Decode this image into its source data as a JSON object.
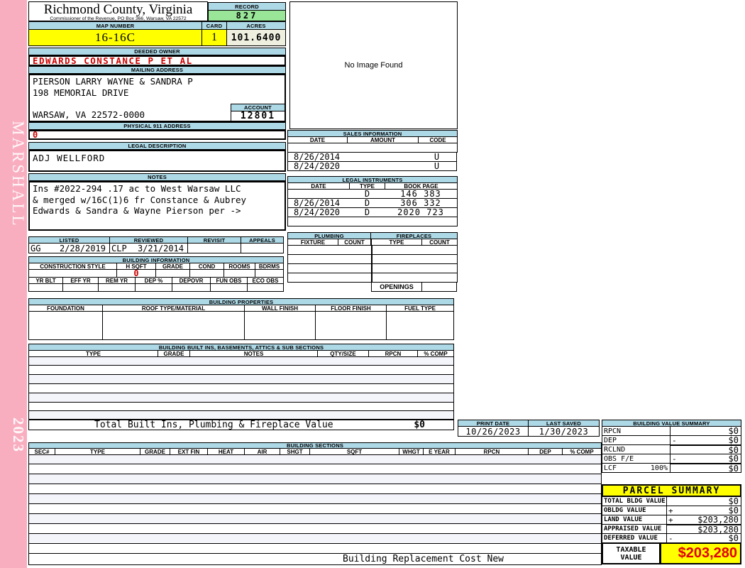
{
  "sidebar": {
    "year_book": "MARSHALL",
    "year": "2023"
  },
  "header": {
    "county": "Richmond County, Virginia",
    "commissioner": "Commissioner of the Revenue, PO Box 366, Warsaw, VA 22572",
    "record_label": "RECORD",
    "record_value": "827",
    "map_number_label": "MAP NUMBER",
    "map_number_value": "16-16C",
    "card_label": "CARD",
    "card_value": "1",
    "acres_label": "ACRES",
    "acres_value": "101.6400"
  },
  "owner": {
    "deeded_owner_label": "DEEDED OWNER",
    "deeded_owner": "EDWARDS CONSTANCE P ET AL",
    "mailing_address_label": "MAILING ADDRESS",
    "mailing_line1": "PIERSON LARRY WAYNE & SANDRA P",
    "mailing_line2": "198 MEMORIAL DRIVE",
    "mailing_line3": "",
    "mailing_line4": "WARSAW, VA 22572-0000",
    "account_label": "ACCOUNT",
    "account_value": "12801",
    "physical_address_label": "PHYSICAL 911 ADDRESS",
    "physical_address_value": "0"
  },
  "legal_description": {
    "title": "LEGAL DESCRIPTION",
    "value": "ADJ WELLFORD"
  },
  "notes": {
    "title": "NOTES",
    "line1": "Ins #2022-294 .17 ac to West Warsaw LLC",
    "line2": "& merged w/16C(1)6 fr Constance & Aubrey",
    "line3": "Edwards & Sandra & Wayne Pierson per ->"
  },
  "image_panel": {
    "message": "No Image Found"
  },
  "sales_information": {
    "title": "SALES INFORMATION",
    "col_date": "DATE",
    "col_amount": "AMOUNT",
    "col_code": "CODE",
    "rows": [
      {
        "date": "",
        "amount": "",
        "code": ""
      },
      {
        "date": "8/26/2014",
        "amount": "",
        "code": "U"
      },
      {
        "date": "8/24/2020",
        "amount": "",
        "code": "U"
      }
    ]
  },
  "legal_instruments": {
    "title": "LEGAL INSTRUMENTS",
    "col_date": "DATE",
    "col_type": "TYPE",
    "col_bookpage": "BOOK PAGE",
    "rows": [
      {
        "date": "",
        "type": "D",
        "bookpage": "146 383"
      },
      {
        "date": "8/26/2014",
        "type": "D",
        "bookpage": "306 332"
      },
      {
        "date": "8/24/2020",
        "type": "D",
        "bookpage": "2020 723"
      },
      {
        "date": "",
        "type": "",
        "bookpage": ""
      }
    ]
  },
  "plumbing": {
    "title": "PLUMBING",
    "col_fixture": "FIXTURE",
    "col_count": "COUNT"
  },
  "fireplaces": {
    "title": "FIREPLACES",
    "col_type": "TYPE",
    "col_count": "COUNT",
    "openings_label": "OPENINGS",
    "openings_value": ""
  },
  "review": {
    "listed_label": "LISTED",
    "reviewed_label": "REVIEWED",
    "revisit_label": "REVISIT",
    "appeals_label": "APPEALS",
    "listed_by": "GG",
    "listed_date": "2/28/2019",
    "reviewed_by": "CLP",
    "reviewed_date": "3/21/2014",
    "revisit": "",
    "appeals": ""
  },
  "building_information": {
    "title": "BUILDING INFORMATION",
    "row1_headers": [
      "CONSTRUCTION STYLE",
      "H SQFT",
      "GRADE",
      "COND",
      "ROOMS",
      "BDRMS"
    ],
    "construction_style": "",
    "h_sqft_value": "0",
    "grade": "",
    "cond": "",
    "rooms": "",
    "bdrms": "",
    "row2_headers": [
      "YR BLT",
      "EFF YR",
      "REM YR",
      "DEP %",
      "DEPOVR",
      "FUN OBS",
      "ECO OBS"
    ]
  },
  "building_properties": {
    "title": "BUILDING PROPERTIES",
    "headers": [
      "FOUNDATION",
      "ROOF TYPE/MATERIAL",
      "WALL FINISH",
      "FLOOR FINISH",
      "FUEL TYPE"
    ]
  },
  "built_ins": {
    "title": "BUILDING BUILT INS, BASEMENTS, ATTICS & SUB SECTIONS",
    "headers": [
      "TYPE",
      "GRADE",
      "NOTES",
      "QTY/SIZE",
      "RPCN",
      "% COMP"
    ],
    "total_label": "Total Built Ins, Plumbing & Fireplace Value",
    "total_value": "$0"
  },
  "print_info": {
    "print_date_label": "PRINT DATE",
    "print_date": "10/26/2023",
    "last_saved_label": "LAST SAVED",
    "last_saved": "1/30/2023"
  },
  "building_value_summary": {
    "title": "BUILDING VALUE SUMMARY",
    "rows": [
      {
        "label": "RPCN",
        "factor": "",
        "op": "",
        "value": "$0"
      },
      {
        "label": "DEP",
        "factor": "",
        "op": "-",
        "value": "$0"
      },
      {
        "label": "RCLND",
        "factor": "",
        "op": "",
        "value": "$0"
      },
      {
        "label": "OBS F/E",
        "factor": "",
        "op": "-",
        "value": "$0"
      },
      {
        "label": "LCF",
        "factor": "100%",
        "op": "",
        "value": "$0"
      }
    ]
  },
  "building_sections": {
    "title": "BUILDING SECTIONS",
    "headers": [
      "SEC#",
      "TYPE",
      "GRADE",
      "EXT FIN",
      "HEAT",
      "AIR",
      "SHGT",
      "SQFT",
      "WHGT",
      "E YEAR",
      "RPCN",
      "DEP",
      "% COMP"
    ],
    "footer": "Building Replacement Cost New"
  },
  "parcel_summary": {
    "title": "PARCEL SUMMARY",
    "rows": [
      {
        "label": "TOTAL BLDG VALUE",
        "op": "",
        "value": "$0"
      },
      {
        "label": "OBLDG VALUE",
        "op": "+",
        "value": "$0"
      },
      {
        "label": "LAND VALUE",
        "op": "+",
        "value": "$203,280"
      },
      {
        "label": "APPRAISED VALUE",
        "op": "",
        "value": "$203,280"
      },
      {
        "label": "DEFERRED VALUE",
        "op": "-",
        "value": "$0"
      }
    ],
    "taxable_label_line1": "TAXABLE",
    "taxable_label_line2": "VALUE",
    "taxable_value": "$203,280"
  },
  "colors": {
    "header_blue": "#ADD8E6",
    "record_green": "#99E699",
    "highlight_yellow": "#FFFF00",
    "acres_cream": "#EFEFE0",
    "sidebar_pink": "#F9AEC0",
    "alert_red": "#CC0000",
    "taxable_red": "#E00000"
  }
}
